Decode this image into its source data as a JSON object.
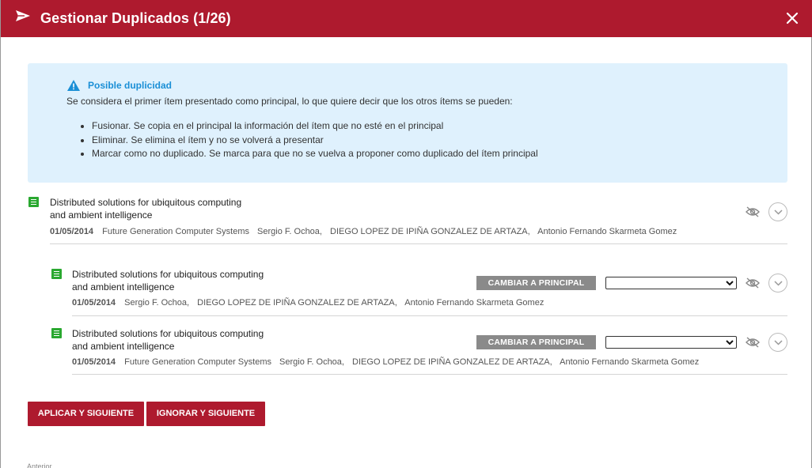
{
  "header": {
    "title": "Gestionar Duplicados (1/26)",
    "icon": "send-icon",
    "close_icon": "close-icon",
    "bg_color": "#ae1a2e"
  },
  "info": {
    "title": "Posible duplicidad",
    "description": "Se considera el primer ítem presentado como principal, lo que quiere decir que los otros ítems se pueden:",
    "bullets": [
      "Fusionar. Se copia en el principal la información del ítem que no esté en el principal",
      "Eliminar. Se elimina el ítem y no se volverá a presentar",
      "Marcar como no duplicado. Se marca para que no se vuelva a proponer como duplicado del ítem principal"
    ],
    "title_color": "#1a8fd6",
    "bg_color": "#dff1fd"
  },
  "items": [
    {
      "title_line1": "Distributed solutions for ubiquitous computing",
      "title_line2": "and ambient intelligence",
      "date": "01/05/2014",
      "meta": [
        "Future Generation Computer Systems",
        "Sergio F. Ochoa,",
        "DIEGO LOPEZ DE IPIÑA GONZALEZ DE ARTAZA,",
        "Antonio Fernando Skarmeta Gomez"
      ]
    },
    {
      "title_line1": "Distributed solutions for ubiquitous computing",
      "title_line2": "and ambient intelligence",
      "date": "01/05/2014",
      "meta": [
        "Sergio F. Ochoa,",
        "DIEGO LOPEZ DE IPIÑA GONZALEZ DE ARTAZA,",
        "Antonio Fernando Skarmeta Gomez"
      ],
      "principal_button": "CAMBIAR A PRINCIPAL",
      "select_value": ""
    },
    {
      "title_line1": "Distributed solutions for ubiquitous computing",
      "title_line2": "and ambient intelligence",
      "date": "01/05/2014",
      "meta": [
        "Future Generation Computer Systems",
        "Sergio F. Ochoa,",
        "DIEGO LOPEZ DE IPIÑA GONZALEZ DE ARTAZA,",
        "Antonio Fernando Skarmeta Gomez"
      ],
      "principal_button": "CAMBIAR A PRINCIPAL",
      "select_value": ""
    }
  ],
  "actions": {
    "apply_next": "APLICAR Y SIGUIENTE",
    "ignore_next": "IGNORAR Y SIGUIENTE"
  },
  "footer_fragment": "Anterior"
}
